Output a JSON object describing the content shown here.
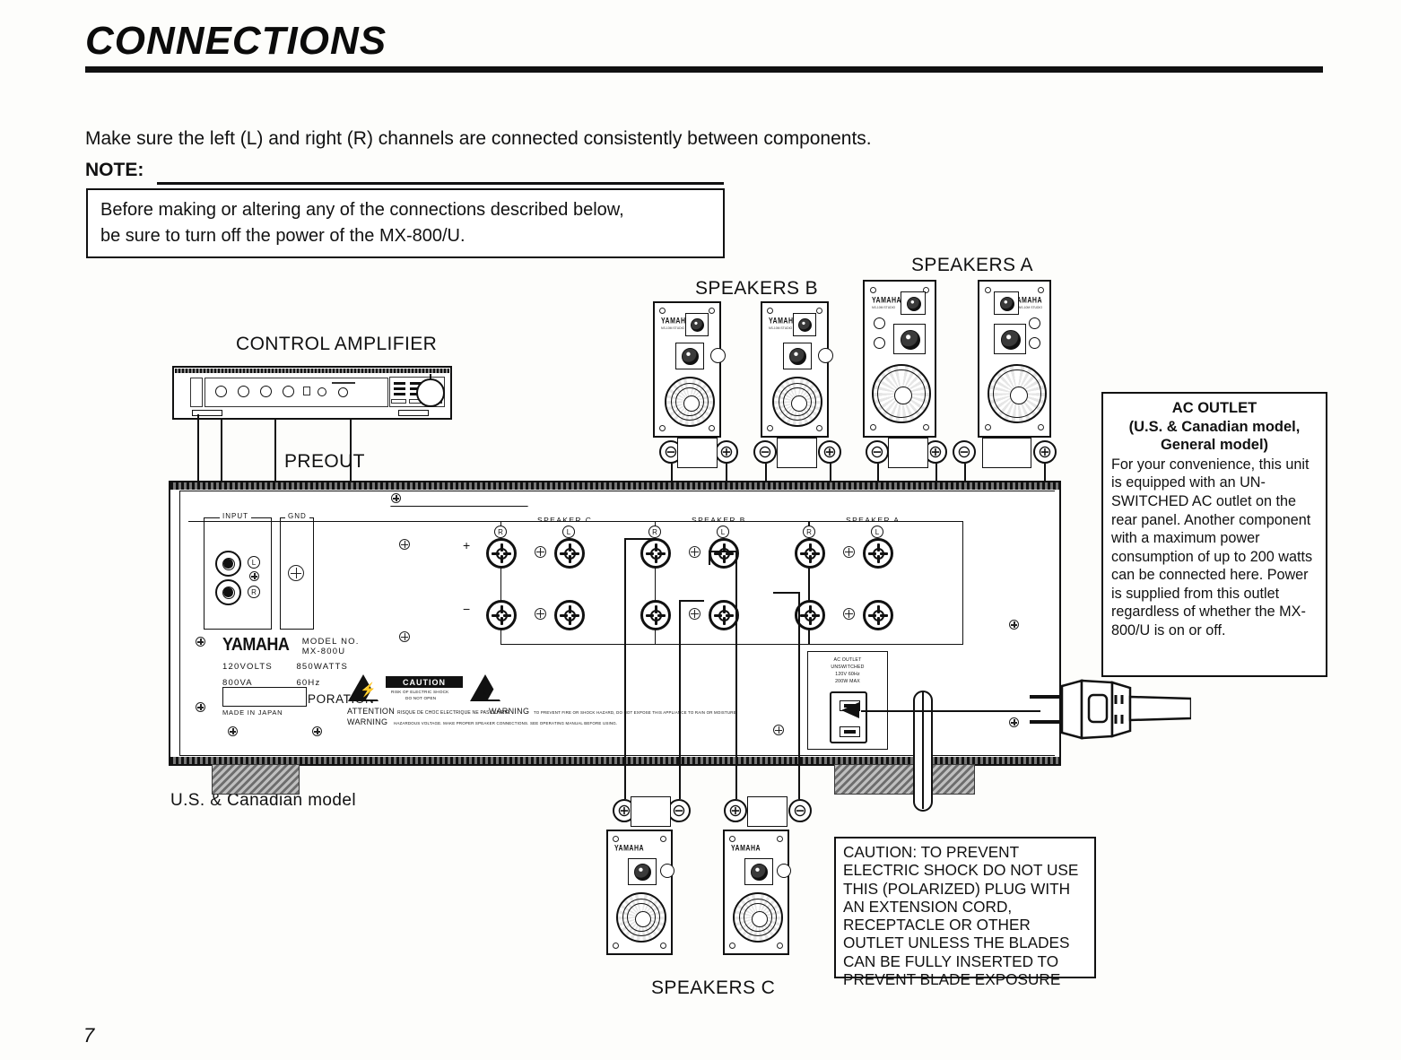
{
  "document": {
    "title": "CONNECTIONS",
    "page_number": "7"
  },
  "intro": {
    "text": "Make sure the left (L) and right (R) channels are connected consistently between components."
  },
  "note": {
    "label": "NOTE:",
    "line1": "Before making or altering any of the connections described below,",
    "line2": "be sure to turn off the power of the MX-800/U."
  },
  "diagram": {
    "control_amplifier_label": "CONTROL AMPLIFIER",
    "preout_label": "PREOUT",
    "model_caption": "U.S. & Canadian model",
    "speakers_a_label": "SPEAKERS A",
    "speakers_b_label": "SPEAKERS B",
    "speakers_c_label": "SPEAKERS C",
    "channel_r": "R",
    "channel_l": "L",
    "plus_sign": "⊕",
    "minus_sign": "⊖",
    "speaker_brand": "YAMAHA",
    "speaker_brand_sub": "NS-10M STUDIO"
  },
  "rear_panel": {
    "input_label": "INPUT",
    "gnd_label": "GND",
    "jack_l": "L",
    "jack_r": "R",
    "speaker_group_a": "SPEAKER A",
    "speaker_group_b": "SPEAKER B",
    "speaker_group_c": "SPEAKER C",
    "terminal_r": "R",
    "terminal_l": "L",
    "plus": "+",
    "minus": "−",
    "brand": "YAMAHA",
    "model_no_label": "MODEL NO.",
    "model_no": "MX-800U",
    "voltage": "120VOLTS",
    "watts": "850WATTS",
    "va": "800VA",
    "hz": "60Hz",
    "corporation": "YAMAHA CORPORATION",
    "made_in": "MADE IN JAPAN",
    "caution_badge": "CAUTION",
    "caution_line1": "RISK OF ELECTRIC SHOCK",
    "caution_line2": "DO NOT OPEN",
    "attention_label": "ATTENTION",
    "attention_text": "RISQUE DE CHOC ELECTRIQUE NE PAS OUVRIR",
    "warning_label": "WARNING",
    "warning_text_1": "TO PREVENT FIRE OR SHOCK HAZARD, DO NOT EXPOSE THIS APPLIANCE TO RAIN OR MOISTURE.",
    "warning_label_2": "WARNING",
    "warning_text_2": "HAZARDOUS VOLTAGE. MAKE PROPER SPEAKER CONNECTIONS. SEE OPERATING MANUAL BEFORE USING.",
    "ac_outlet_line1": "AC OUTLET",
    "ac_outlet_line2": "UNSWITCHED",
    "ac_outlet_line3": "120V 60Hz",
    "ac_outlet_line4": "200W MAX"
  },
  "ac_outlet_note": {
    "heading_line1": "AC OUTLET",
    "heading_line2": "(U.S. & Canadian model,",
    "heading_line3": "General model)",
    "body": "For your convenience, this unit is equipped with an UN-SWITCHED AC outlet on the rear panel. Another component with a maximum power consumption of up to 200 watts can be connected here. Power is supplied from this outlet regardless of whether the MX-800/U is on or off."
  },
  "caution_plug_note": {
    "body": "CAUTION: TO PREVENT ELECTRIC SHOCK DO NOT USE THIS (POLARIZED) PLUG WITH AN EXTENSION CORD, RECEPTACLE OR OTHER OUTLET UNLESS THE BLADES CAN BE FULLY INSERTED TO PREVENT BLADE EXPOSURE"
  },
  "colors": {
    "ink": "#111111",
    "paper": "#fdfdfb"
  }
}
